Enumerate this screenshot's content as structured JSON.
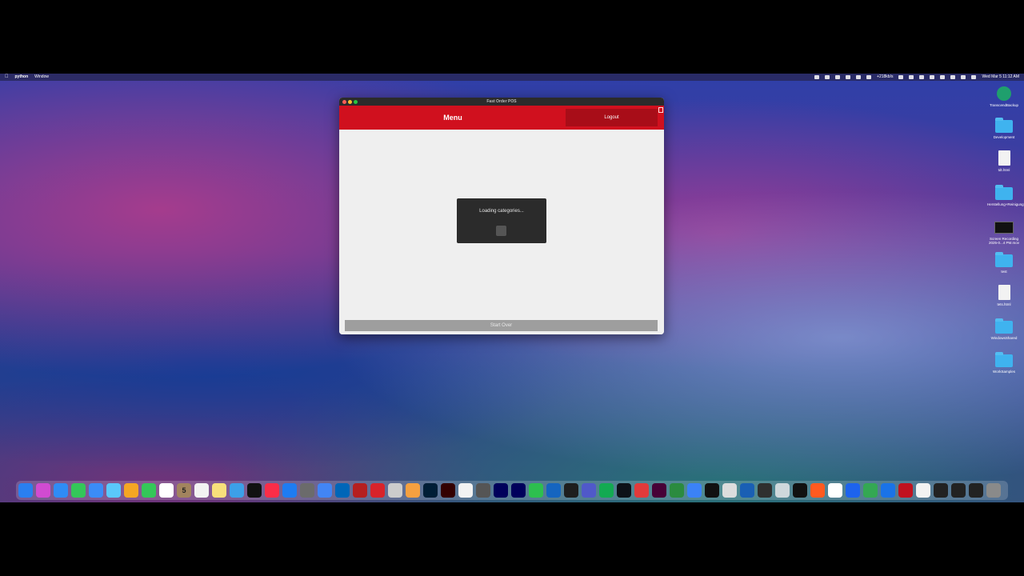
{
  "menubar": {
    "app_name": "python",
    "menu_window": "Window",
    "network_speed": "+218kb/s",
    "datetime": "Wed Mar 5  11:12 AM"
  },
  "window": {
    "title": "Fast Order POS",
    "header_title": "Menu",
    "logout_label": "Logout",
    "loading_text": "Loading categories...",
    "start_over_label": "Start Over",
    "accent_color": "#d0101e"
  },
  "desktop_icons": [
    {
      "label": "TranscendBackup",
      "icon": "time-machine-icon"
    },
    {
      "label": "Development",
      "icon": "folder-icon"
    },
    {
      "label": "tdt.html",
      "icon": "html-file-icon"
    },
    {
      "label": "Herstellung+Reinigung",
      "icon": "folder-icon"
    },
    {
      "label": "Screen Recording 2025-0...4 PM.mov",
      "icon": "video-file-icon"
    },
    {
      "label": "test",
      "icon": "folder-icon"
    },
    {
      "label": "tets.html",
      "icon": "html-file-icon"
    },
    {
      "label": "WindowsShared",
      "icon": "folder-icon"
    },
    {
      "label": "WorkSamples",
      "icon": "folder-icon"
    }
  ],
  "dock": {
    "calendar_day": "5",
    "app_colors": [
      "#2a7ff0",
      "#d14bd1",
      "#2f8cf5",
      "#34c759",
      "#3b8cf7",
      "#5ac8fa",
      "#f5a623",
      "#34c759",
      "#ffffff",
      "#a2845e",
      "#f2f2f2",
      "#f7e07b",
      "#3ca0e8",
      "#111111",
      "#fa2d48",
      "#1e7cf2",
      "#6b6b6b",
      "#4285f4",
      "#0066b8",
      "#b51f1f",
      "#d8232a",
      "#cccccc",
      "#f5a040",
      "#001e36",
      "#330000",
      "#f2f2f2",
      "#555555",
      "#00005b",
      "#00005b",
      "#2dbf4f",
      "#1565c0",
      "#1e1e1e",
      "#5059c9",
      "#13aa52",
      "#0d1117",
      "#e23a3a",
      "#470137",
      "#2b8b3f",
      "#3b82f6",
      "#111111",
      "#dddddd",
      "#1a5fb4",
      "#2f2f2f",
      "#cfd8dc",
      "#111111",
      "#ff5a1f",
      "#ffffff",
      "#1d63ed",
      "#34a853",
      "#1a73e8",
      "#c1121f",
      "#f2f2f2",
      "#222222",
      "#222222",
      "#222222",
      "#8a8a8a"
    ]
  }
}
